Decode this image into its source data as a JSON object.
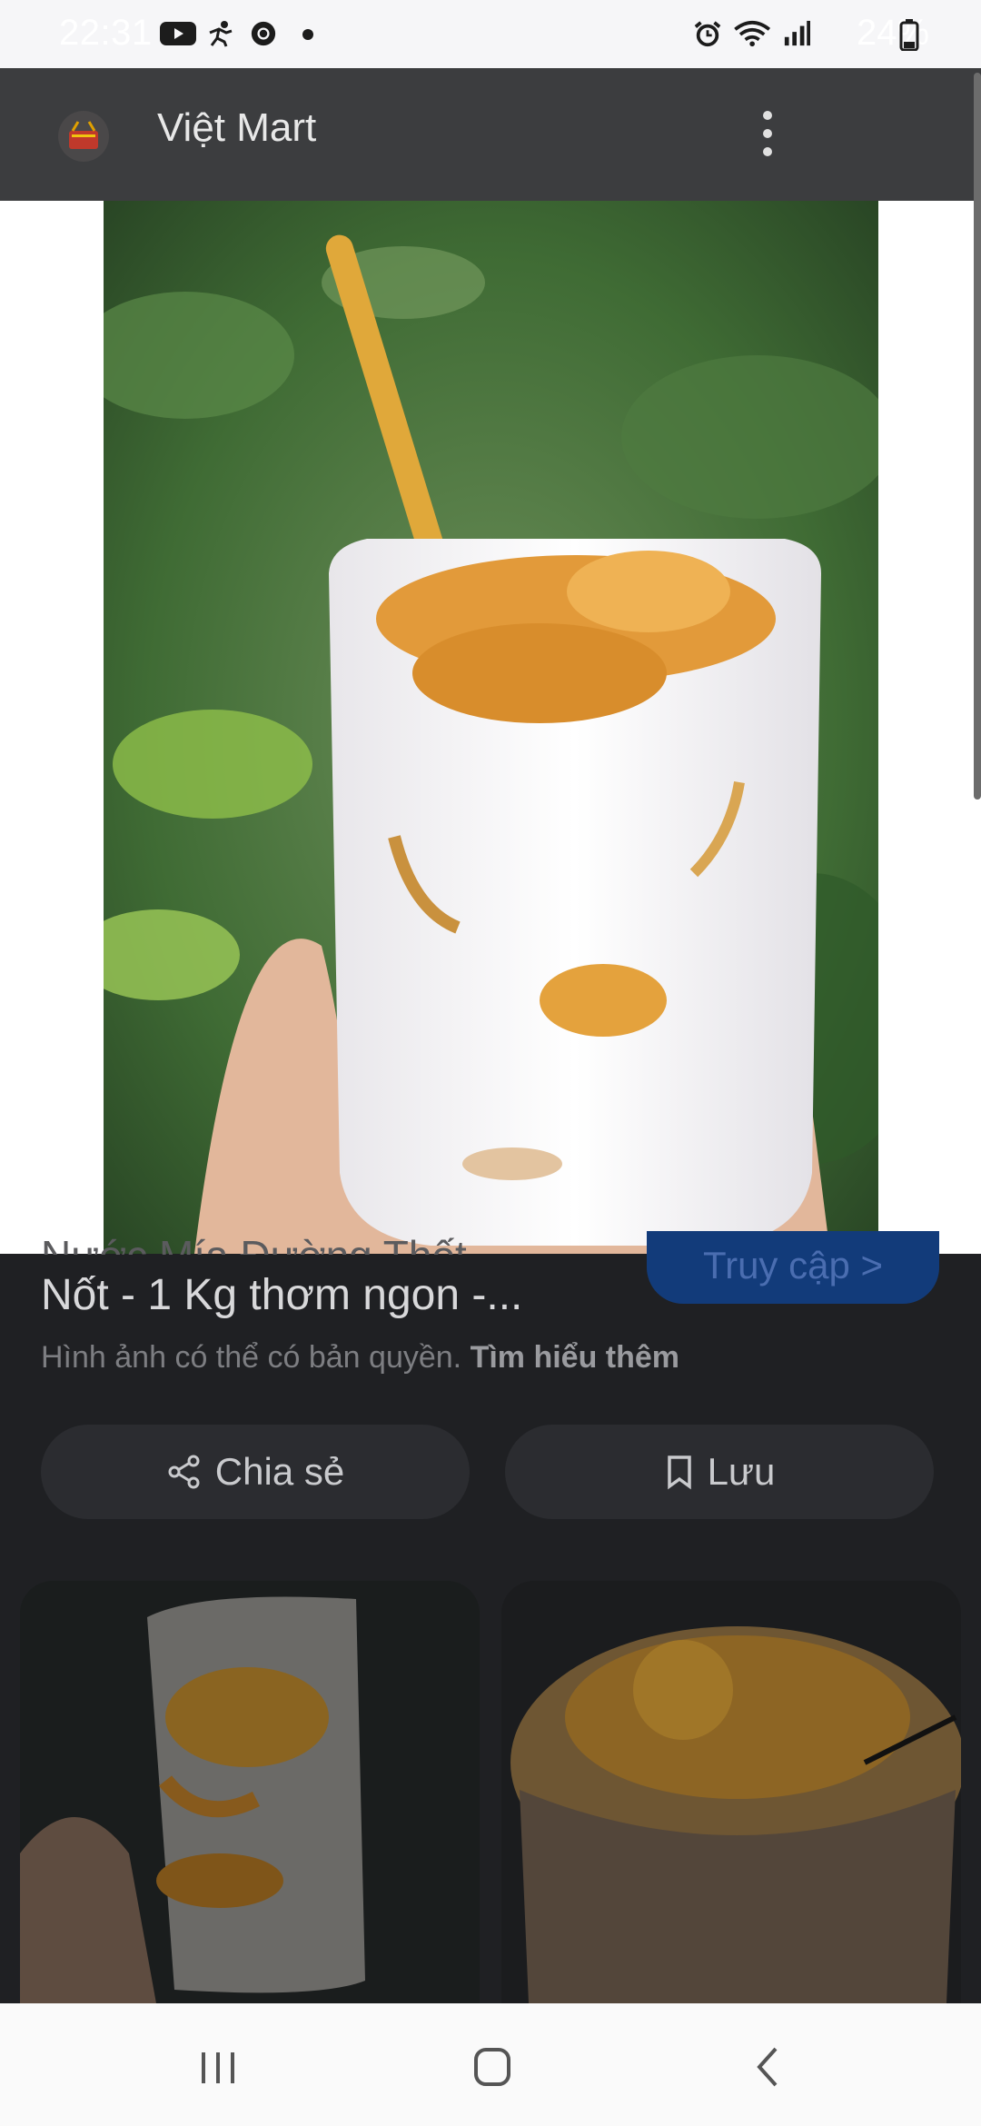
{
  "status_bar": {
    "time": "22:31",
    "battery_percent": "24%",
    "left_icons": [
      "youtube-icon",
      "fitness-icon",
      "chrome-icon",
      "dot-icon"
    ],
    "right_icons": [
      "alarm-icon",
      "wifi-icon",
      "signal-icon",
      "battery-icon"
    ]
  },
  "app_bar": {
    "title": "Việt Mart",
    "logo_icon": "shopping-basket-logo-icon",
    "menu_icon": "more-vert-icon"
  },
  "hero": {
    "description_icon": "product-photo"
  },
  "lower": {
    "title_fragment": "Nước Mía Đường Thốt",
    "visit_label": "Truy cập >",
    "product_title": "Nốt - 1 Kg thơm ngon -...",
    "copyright_text": "Hình ảnh có thể có bản quyền.",
    "learn_more": "Tìm hiểu thêm",
    "share_label": "Chia sẻ",
    "save_label": "Lưu"
  },
  "colors": {
    "app_bar": "#3c3d3f",
    "panel": "#1f2023",
    "visit_button": "#123b7a",
    "pill": "#2b2c30"
  }
}
